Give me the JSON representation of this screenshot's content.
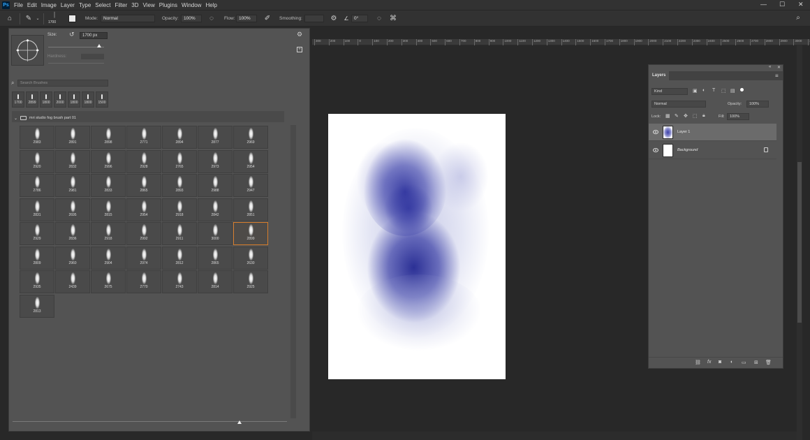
{
  "menubar": {
    "logo": "Ps",
    "items": [
      "File",
      "Edit",
      "Image",
      "Layer",
      "Type",
      "Select",
      "Filter",
      "3D",
      "View",
      "Plugins",
      "Window",
      "Help"
    ],
    "window_controls": [
      "—",
      "☐",
      "✕"
    ]
  },
  "options": {
    "brush_size": "1700",
    "mode_label": "Mode:",
    "mode_value": "Normal",
    "opacity_label": "Opacity:",
    "opacity_value": "100%",
    "flow_label": "Flow:",
    "flow_value": "100%",
    "smoothing_label": "Smoothing:",
    "smoothing_value": "",
    "angle_value": "0°"
  },
  "brush_panel": {
    "size_label": "Size:",
    "size_value": "1700 px",
    "hardness_label": "Hardness:",
    "search_placeholder": "Search Brushes",
    "recent": [
      "1700",
      "2899",
      "1800",
      "2000",
      "1800",
      "1800",
      "1500"
    ],
    "group_name": "mri studio fog brush part 01",
    "brushes": [
      [
        "2983",
        "2891",
        "2898",
        "2771",
        "2894",
        "2877",
        "2969"
      ],
      [
        "2920",
        "2832",
        "2996",
        "2928",
        "2765",
        "2973",
        "2954"
      ],
      [
        "2786",
        "2981",
        "2833",
        "2865",
        "2893",
        "2988",
        "2947"
      ],
      [
        "2831",
        "2695",
        "2815",
        "2954",
        "2918",
        "2842",
        "2851"
      ],
      [
        "2929",
        "2836",
        "2918",
        "2992",
        "2911",
        "3000",
        "2899"
      ],
      [
        "2809",
        "2960",
        "2904",
        "2974",
        "2812",
        "2865",
        "2630"
      ],
      [
        "2935",
        "2439",
        "2675",
        "2770",
        "2743",
        "2814",
        "2925"
      ],
      [
        "2813"
      ]
    ],
    "selected_brush": "2899"
  },
  "ruler": {
    "ticks": [
      "300",
      "200",
      "100",
      "0",
      "100",
      "200",
      "300",
      "400",
      "500",
      "600",
      "700",
      "800",
      "900",
      "1000",
      "1100",
      "1200",
      "1300",
      "1400",
      "1500",
      "1600",
      "1700",
      "1800",
      "1900",
      "2000",
      "2100",
      "2200",
      "2300",
      "2400",
      "2500",
      "2600",
      "2700",
      "2800",
      "2900",
      "3000",
      "3100",
      "3200"
    ]
  },
  "layers": {
    "title": "Layers",
    "filter_kind": "Kind",
    "blend_mode": "Normal",
    "opacity_label": "Opacity:",
    "opacity_value": "100%",
    "lock_label": "Lock:",
    "fill_label": "Fill:",
    "fill_value": "100%",
    "items": [
      {
        "name": "Layer 1",
        "active": true
      },
      {
        "name": "Background",
        "active": false
      }
    ],
    "footer_icons": [
      "link-icon",
      "fx-icon",
      "mask-icon",
      "adjustment-icon",
      "folder-icon",
      "new-layer-icon",
      "trash-icon"
    ]
  },
  "colors": {
    "accent_selected": "#d47b2b",
    "fog": "#2a2d9c"
  }
}
